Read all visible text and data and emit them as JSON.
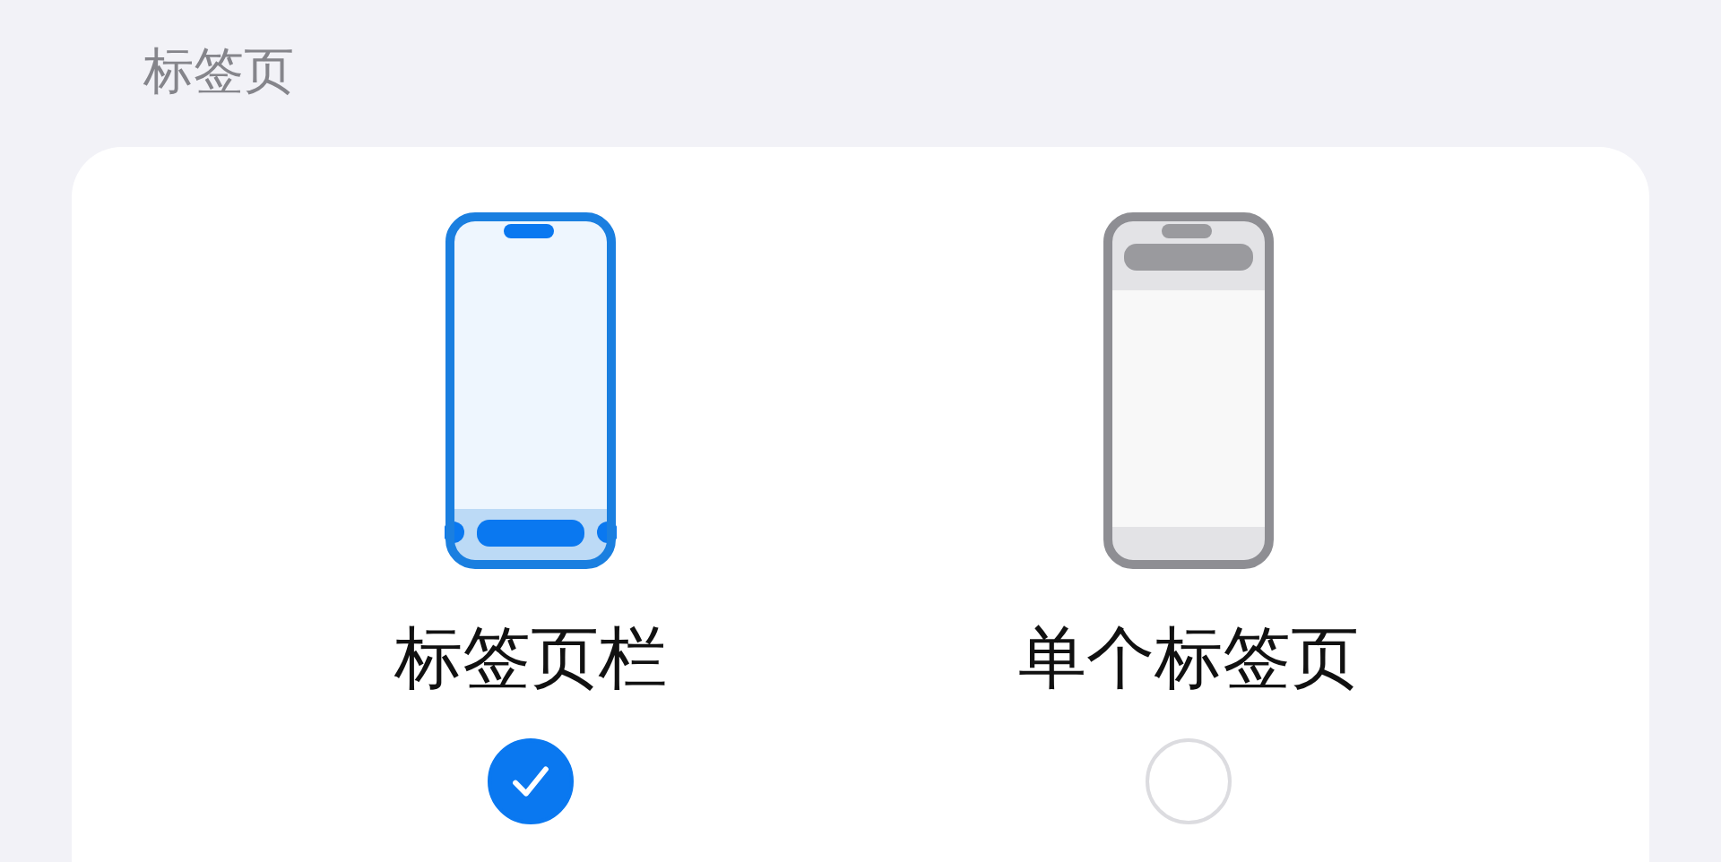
{
  "section": {
    "title": "标签页"
  },
  "options": [
    {
      "kind": "tab-bar",
      "label": "标签页栏",
      "selected": true
    },
    {
      "kind": "single",
      "label": "单个标签页",
      "selected": false
    }
  ]
}
